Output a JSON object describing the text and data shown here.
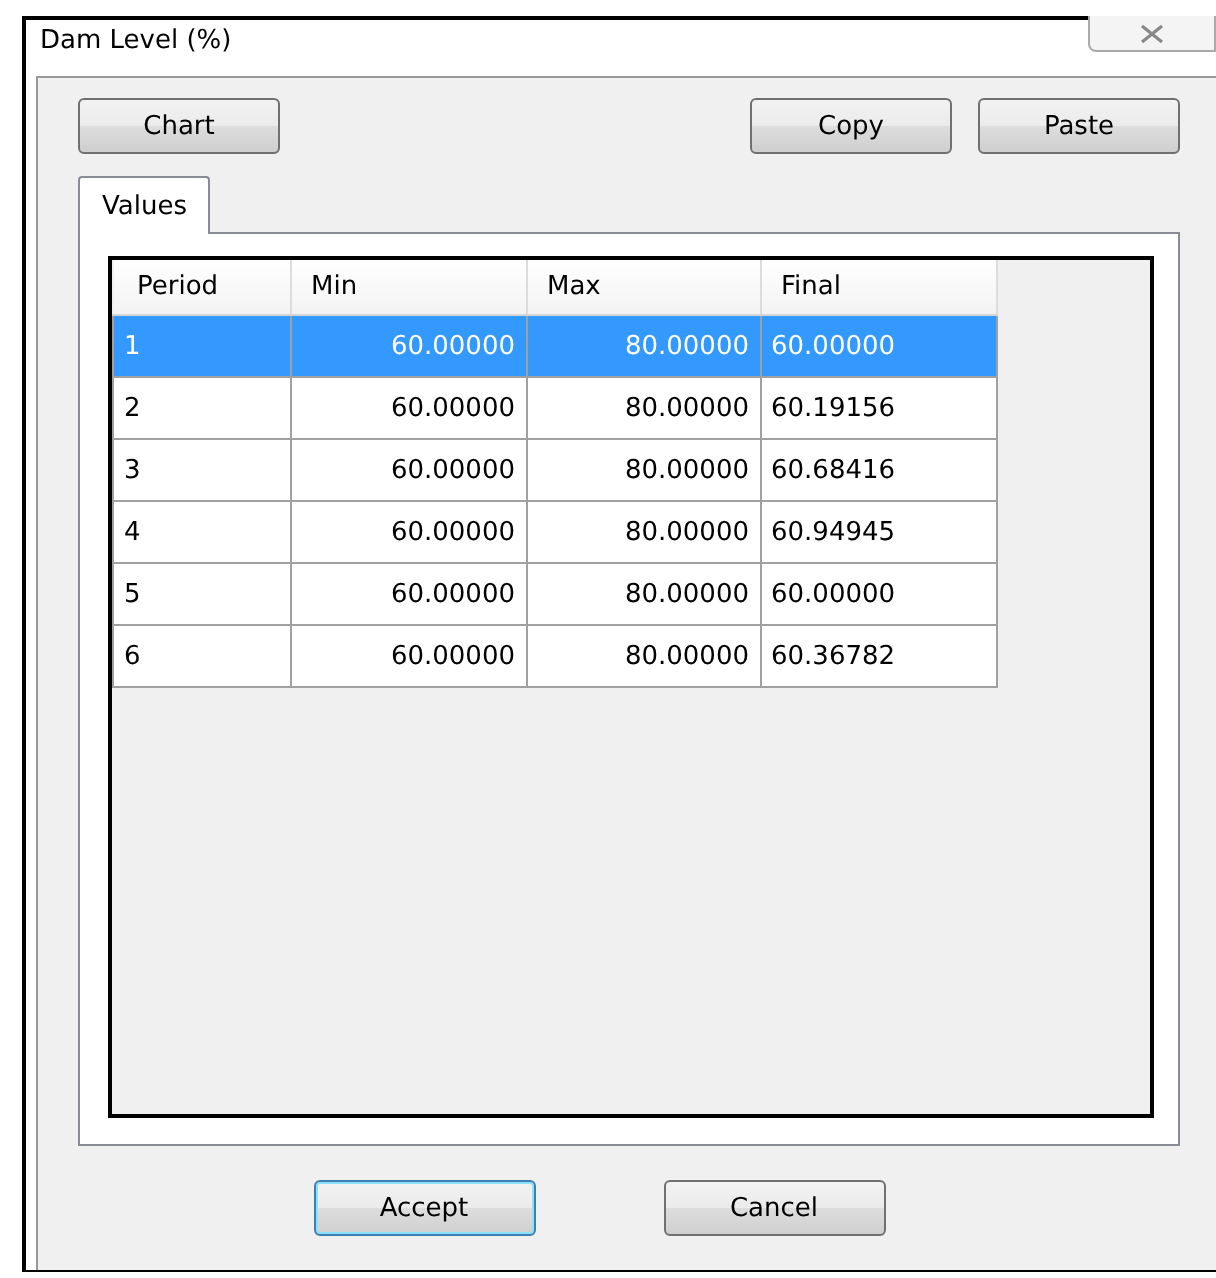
{
  "window": {
    "title": "Dam Level (%)"
  },
  "toolbar": {
    "left": [
      {
        "label": "Chart"
      }
    ],
    "right": [
      {
        "label": "Copy"
      },
      {
        "label": "Paste"
      }
    ]
  },
  "tabs": [
    {
      "label": "Values",
      "selected": true
    }
  ],
  "table": {
    "columns": [
      "Period",
      "Min",
      "Max",
      "Final"
    ],
    "rows": [
      {
        "cells": [
          "1",
          "60.00000",
          "80.00000",
          "60.00000"
        ],
        "selected": true
      },
      {
        "cells": [
          "2",
          "60.00000",
          "80.00000",
          "60.19156"
        ],
        "selected": false
      },
      {
        "cells": [
          "3",
          "60.00000",
          "80.00000",
          "60.68416"
        ],
        "selected": false
      },
      {
        "cells": [
          "4",
          "60.00000",
          "80.00000",
          "60.94945"
        ],
        "selected": false
      },
      {
        "cells": [
          "5",
          "60.00000",
          "80.00000",
          "60.00000"
        ],
        "selected": false
      },
      {
        "cells": [
          "6",
          "60.00000",
          "80.00000",
          "60.36782"
        ],
        "selected": false
      }
    ]
  },
  "buttons": [
    {
      "label": "Accept",
      "default": true
    },
    {
      "label": "Cancel",
      "default": false
    }
  ]
}
